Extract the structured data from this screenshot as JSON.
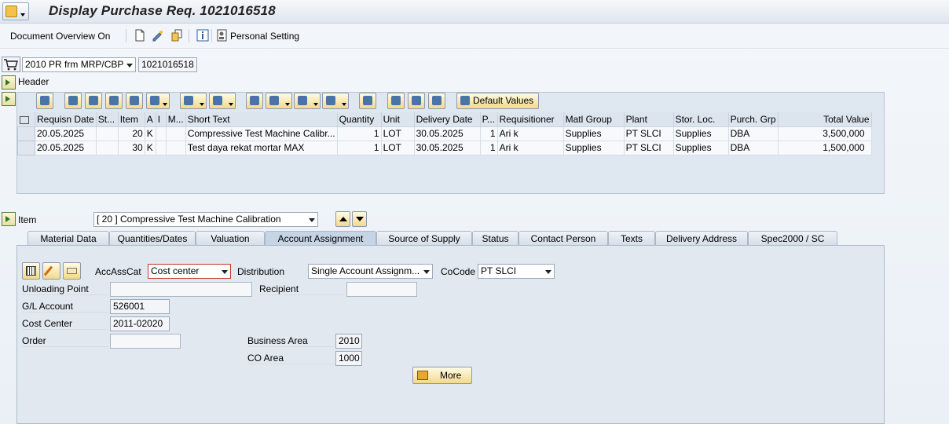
{
  "window": {
    "title": "Display Purchase Req. 1021016518"
  },
  "toolbar": {
    "doc_overview": "Document Overview On",
    "personal_setting": "Personal Setting"
  },
  "header_row": {
    "doc_type": "2010 PR frm MRP/CBP",
    "pr_number": "1021016518"
  },
  "header_label": "Header",
  "grid_toolbar": {
    "default_values": "Default Values"
  },
  "grid": {
    "columns": [
      "Requisn Date",
      "St...",
      "Item",
      "A",
      "I",
      "M...",
      "Short Text",
      "Quantity",
      "Unit",
      "Delivery Date",
      "P...",
      "Requisitioner",
      "Matl Group",
      "Plant",
      "Stor. Loc.",
      "Purch. Grp",
      "Total Value"
    ],
    "rows": [
      [
        "20.05.2025",
        "",
        "20",
        "K",
        "",
        "",
        "Compressive Test Machine Calibr...",
        "1",
        "LOT",
        "30.05.2025",
        "1",
        "Ari k",
        "Supplies",
        "PT SLCI",
        "Supplies",
        "DBA",
        "3,500,000"
      ],
      [
        "20.05.2025",
        "",
        "30",
        "K",
        "",
        "",
        "Test daya rekat mortar MAX",
        "1",
        "LOT",
        "30.05.2025",
        "1",
        "Ari k",
        "Supplies",
        "PT SLCI",
        "Supplies",
        "DBA",
        "1,500,000"
      ]
    ]
  },
  "item": {
    "label": "Item",
    "value": "[ 20 ] Compressive Test Machine Calibration"
  },
  "tabs": [
    "Material Data",
    "Quantities/Dates",
    "Valuation",
    "Account Assignment",
    "Source of Supply",
    "Status",
    "Contact Person",
    "Texts",
    "Delivery Address",
    "Spec2000 / SC"
  ],
  "active_tab": "Account Assignment",
  "account": {
    "accasscat_label": "AccAssCat",
    "accasscat_value": "Cost center",
    "distribution_label": "Distribution",
    "distribution_value": "Single Account Assignm...",
    "cocode_label": "CoCode",
    "cocode_value": "PT SLCI",
    "unloading_label": "Unloading Point",
    "unloading_value": "",
    "recipient_label": "Recipient",
    "recipient_value": "",
    "gl_label": "G/L Account",
    "gl_value": "526001",
    "costcenter_label": "Cost Center",
    "costcenter_value": "2011-02020",
    "order_label": "Order",
    "order_value": "",
    "busarea_label": "Business Area",
    "busarea_value": "2010",
    "coarea_label": "CO Area",
    "coarea_value": "1000",
    "more_label": "More"
  }
}
